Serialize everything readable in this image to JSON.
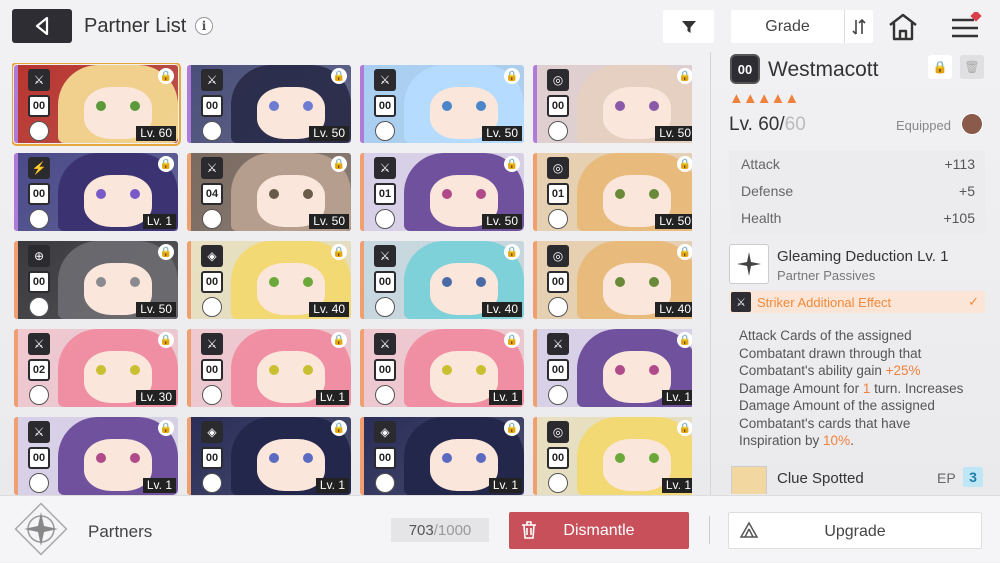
{
  "header": {
    "title": "Partner List",
    "info_icon": "i",
    "sort_label": "Grade",
    "filter_icon": "filter-icon",
    "sort_icon": "sort-toggle-icon",
    "home_icon": "home-icon",
    "menu_icon": "menu-icon"
  },
  "partners": [
    {
      "num": "00",
      "level": "Lv. 60",
      "lock": "🔒",
      "stripe": "#b07ad8",
      "bg": "#b8352f",
      "hair": "#f2d890",
      "eye": "#5a9a3a",
      "selected": true
    },
    {
      "num": "00",
      "level": "Lv. 50",
      "lock": "🔒",
      "stripe": "#b07ad8",
      "bg": "#4a4f7a",
      "hair": "#2a2c4a",
      "eye": "#6d7bd1"
    },
    {
      "num": "00",
      "level": "Lv. 50",
      "lock": "🔒",
      "stripe": "#b07ad8",
      "bg": "#a8cff2",
      "hair": "#b5dcff",
      "eye": "#4b86c8"
    },
    {
      "num": "00",
      "level": "Lv. 50",
      "lock": "🔒",
      "stripe": "#b07ad8",
      "bg": "#e0cfd0",
      "hair": "#e5d0c0",
      "eye": "#8a5aa8"
    },
    {
      "num": "00",
      "level": "Lv. 1",
      "lock": "🔒",
      "stripe": "#b07ad8",
      "bg": "#4a4a8a",
      "hair": "#3a3270",
      "eye": "#7a5ac8"
    },
    {
      "num": "04",
      "level": "Lv. 50",
      "lock": "🔒",
      "stripe": "#f0a070",
      "bg": "#7a6a60",
      "hair": "#b8a090",
      "eye": "#6a5a4a"
    },
    {
      "num": "01",
      "level": "Lv. 50",
      "lock": "🔒",
      "stripe": "#f0a070",
      "bg": "#d8d0e8",
      "hair": "#6a4a9a",
      "eye": "#b04a8a"
    },
    {
      "num": "01",
      "level": "Lv. 50",
      "lock": "🔒",
      "stripe": "#f0a070",
      "bg": "#e8d0b0",
      "hair": "#e8b878",
      "eye": "#6a8a3a"
    },
    {
      "num": "00",
      "level": "Lv. 50",
      "lock": "🔒",
      "stripe": "#f0a070",
      "bg": "#3a3a3e",
      "hair": "#6a6a70",
      "eye": "#8a8a90"
    },
    {
      "num": "00",
      "level": "Lv. 40",
      "lock": "🔒",
      "stripe": "#f0a070",
      "bg": "#e8e0c0",
      "hair": "#f2d870",
      "eye": "#6aa83a"
    },
    {
      "num": "00",
      "level": "Lv. 40",
      "lock": "🔒",
      "stripe": "#f0a070",
      "bg": "#c8d8e0",
      "hair": "#7ad0d8",
      "eye": "#4a6aa8"
    },
    {
      "num": "00",
      "level": "Lv. 40",
      "lock": "🔒",
      "stripe": "#f0a070",
      "bg": "#e8d0b0",
      "hair": "#e8b878",
      "eye": "#6a8a3a"
    },
    {
      "num": "02",
      "level": "Lv. 30",
      "lock": "🔒",
      "stripe": "#f0a070",
      "bg": "#f0c8d0",
      "hair": "#f08ca0",
      "eye": "#c8c030"
    },
    {
      "num": "00",
      "level": "Lv. 1",
      "lock": "🔒",
      "stripe": "#f0a070",
      "bg": "#f0c8d0",
      "hair": "#f08ca0",
      "eye": "#c8c030"
    },
    {
      "num": "00",
      "level": "Lv. 1",
      "lock": "🔒",
      "stripe": "#f0a070",
      "bg": "#f0c8d0",
      "hair": "#f08ca0",
      "eye": "#c8c030"
    },
    {
      "num": "00",
      "level": "Lv. 1",
      "lock": "🔒",
      "stripe": "#f0a070",
      "bg": "#d8d0e8",
      "hair": "#6a4a9a",
      "eye": "#b04a8a"
    },
    {
      "num": "00",
      "level": "Lv. 1",
      "lock": "🔒",
      "stripe": "#f0a070",
      "bg": "#d8d0e8",
      "hair": "#6a4a9a",
      "eye": "#b04a8a"
    },
    {
      "num": "00",
      "level": "Lv. 1",
      "lock": "🔒",
      "stripe": "#f0a070",
      "bg": "#2a2e58",
      "hair": "#22264a",
      "eye": "#5a6ac0"
    },
    {
      "num": "00",
      "level": "Lv. 1",
      "lock": "🔒",
      "stripe": "#f0a070",
      "bg": "#2a2e58",
      "hair": "#22264a",
      "eye": "#5a6ac0"
    },
    {
      "num": "00",
      "level": "Lv. 1",
      "lock": "🔒",
      "stripe": "#f0a070",
      "bg": "#e8e0c0",
      "hair": "#f2d870",
      "eye": "#6aa83a"
    }
  ],
  "detail": {
    "num": "00",
    "name": "Westmacott",
    "stars": "▲▲▲▲▲",
    "level": "Lv. 60/",
    "level_max": "60",
    "equipped": "Equipped",
    "stats": [
      {
        "label": "Attack",
        "value": "+113"
      },
      {
        "label": "Defense",
        "value": "+5"
      },
      {
        "label": "Health",
        "value": "+105"
      }
    ],
    "skill_name": "Gleaming Deduction Lv. 1",
    "skill_type": "Partner Passives",
    "striker_label": "Striker Additional Effect",
    "description_1": "Attack Cards of the assigned Combatant drawn through that Combatant's ability gain ",
    "description_hl1": "+25%",
    "description_2": " Damage Amount for ",
    "description_hl2": "1",
    "description_3": " turn. Increases Damage Amount of the assigned Combatant's cards that have Inspiration by ",
    "description_hl3": "10%",
    "description_4": ".",
    "clue_name": "Clue Spotted",
    "ep_label": "EP",
    "ep_value": "3"
  },
  "footer": {
    "label": "Partners",
    "count": "703",
    "count_sep": " / ",
    "count_max": "1000",
    "dismantle_label": "Dismantle",
    "upgrade_label": "Upgrade"
  },
  "colors": {
    "accent": "#f0813c",
    "dismantle": "#c8505b",
    "selected_outline": "#e8a53a"
  }
}
